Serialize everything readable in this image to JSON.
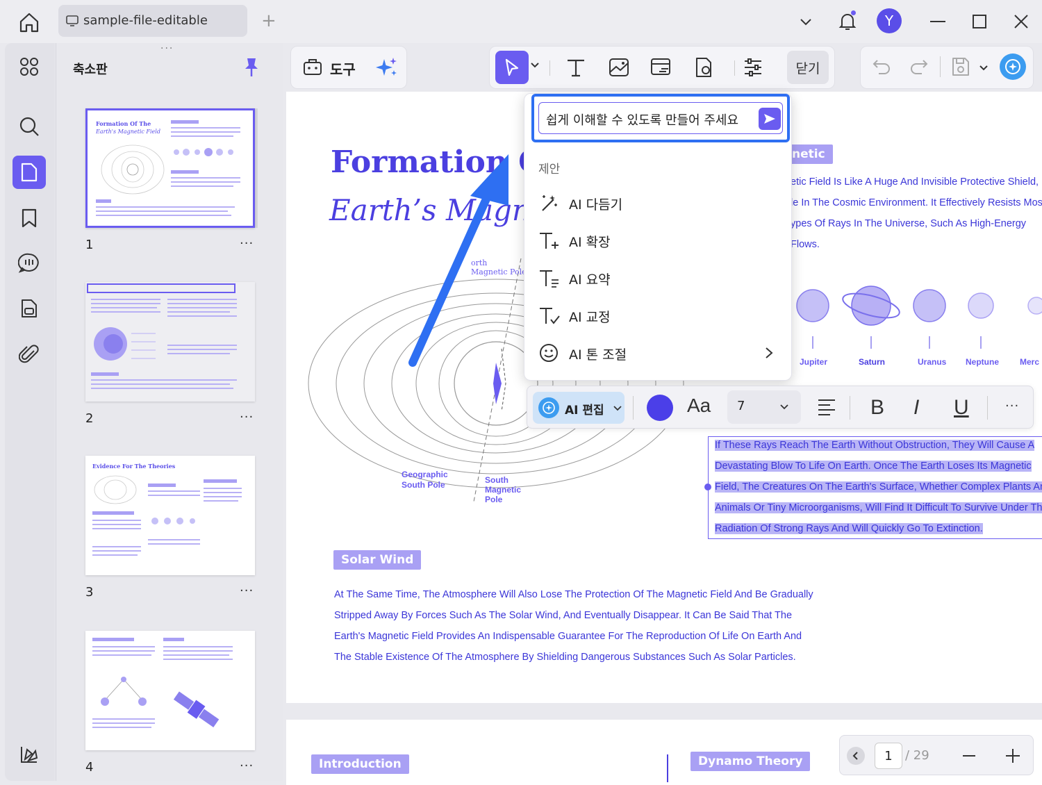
{
  "tab": {
    "title": "sample-file-editable"
  },
  "user": {
    "avatar_letter": "Y"
  },
  "panel": {
    "title": "축소판"
  },
  "thumbnails": [
    {
      "page": "1",
      "heading_a": "Formation Of The",
      "heading_b": "Earth's Magnetic Field"
    },
    {
      "page": "2"
    },
    {
      "page": "3",
      "heading_a": "Evidence For The Theories"
    },
    {
      "page": "4"
    }
  ],
  "toolbar": {
    "tools_label": "도구",
    "close_label": "닫기"
  },
  "document": {
    "title_line1": "Formation Of",
    "title_line2": "Earth’s Magnetic",
    "tag_magnetic": "netic",
    "intro_lines": [
      "etic Field Is Like A Huge And Invisible Protective Shield,",
      "le In The Cosmic Environment. It Effectively Resists Most",
      "ypes Of Rays In The Universe, Such As High-Energy",
      "Flows."
    ],
    "planets": [
      "Jupiter",
      "Saturn",
      "Uranus",
      "Neptune",
      "Merc"
    ],
    "diagram_labels": {
      "north": "orth",
      "north2": "Magnetic Pole",
      "geo_south_1": "Geographic",
      "geo_south_2": "South Pole",
      "south_1": "South",
      "south_2": "Magnetic",
      "south_3": "Pole"
    },
    "selected_lines": [
      "If These Rays Reach The Earth Without Obstruction, They Will Cause A",
      "Devastating Blow To Life On Earth. Once The Earth Loses Its Magnetic",
      "Field, The Creatures On The Earth's Surface, Whether Complex Plants And",
      "Animals Or Tiny Microorganisms, Will Find It Difficult To Survive Under The",
      "Radiation Of Strong Rays And Will Quickly Go To Extinction."
    ],
    "solar_wind_tag": "Solar Wind",
    "solar_lines": [
      "At The Same Time, The Atmosphere Will Also Lose The Protection Of The Magnetic Field And Be Gradually",
      "Stripped Away By Forces Such As The Solar Wind, And Eventually Disappear. It Can Be Said That The",
      "Earth's Magnetic Field Provides An Indispensable Guarantee For The Reproduction Of Life On Earth And",
      "The Stable Existence Of The Atmosphere By Shielding Dangerous Substances Such As Solar Particles."
    ],
    "page2_tag_left": "Introduction",
    "page2_tag_right": "Dynamo Theory"
  },
  "ai_popup": {
    "input_value": "쉽게 이해할 수 있도록 만들어 주세요",
    "suggestions_label": "제안",
    "items": [
      {
        "label": "AI 다듬기",
        "icon": "magic-wand-icon"
      },
      {
        "label": "AI 확장",
        "icon": "text-expand-icon"
      },
      {
        "label": "AI 요약",
        "icon": "text-summarize-icon"
      },
      {
        "label": "AI 교정",
        "icon": "text-proofread-icon"
      },
      {
        "label": "AI 톤 조절",
        "icon": "smile-icon"
      }
    ]
  },
  "format_bar": {
    "ai_edit_label": "AI 편집",
    "font_label": "Aa",
    "font_size": "7",
    "bold": "B",
    "italic": "I",
    "underline": "U",
    "text_color": "#4b3fe8"
  },
  "pager": {
    "current": "1",
    "total": "/ 29"
  },
  "colors": {
    "accent": "#6a5cf0",
    "doc_blue": "#3b36d8",
    "highlight": "#2e6ff2"
  }
}
